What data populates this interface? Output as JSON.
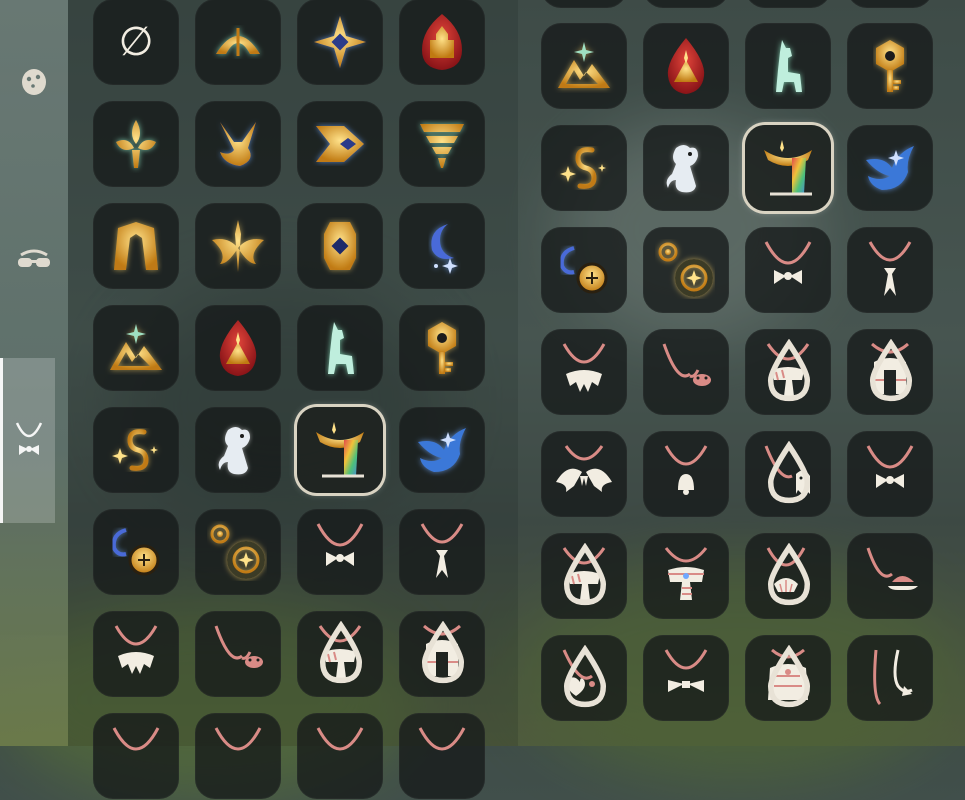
{
  "sidebar": {
    "items": [
      {
        "icon": "face-mask-icon",
        "active": false
      },
      {
        "icon": "sunglasses-icon",
        "active": false
      },
      {
        "icon": "neck-accessory-icon",
        "active": true
      }
    ]
  },
  "empty_slot_symbol": "∅",
  "left_grid": [
    [
      "empty-slot",
      "aquatic-emblem",
      "star-diamond-emblem",
      "castle-emblem"
    ],
    [
      "fleur-emblem",
      "fox-emblem",
      "fish-arrow-emblem",
      "tornado-emblem"
    ],
    [
      "arch-emblem",
      "bird-wings-emblem",
      "gem-emblem",
      "moon-stars-emblem"
    ],
    [
      "mountains-emblem",
      "drop-mountain-emblem",
      "llama-emblem",
      "key-emblem"
    ],
    [
      "swirl-emblem",
      "rat-emblem",
      "rainbow-bowl-emblem",
      "blue-bird-emblem"
    ],
    [
      "crescent-lantern-emblem",
      "gear-emblem",
      "bow-necklace",
      "tie-necklace"
    ],
    [
      "fur-collar-necklace",
      "crab-necklace",
      "scarf-necklace",
      "pendant-bib-necklace"
    ],
    [
      "necklace",
      "necklace",
      "necklace",
      "necklace"
    ]
  ],
  "right_grid": [
    [
      "mountains-emblem",
      "drop-mountain-emblem",
      "llama-emblem",
      "key-emblem"
    ],
    [
      "swirl-emblem",
      "rat-emblem",
      "rainbow-bowl-emblem",
      "blue-bird-emblem"
    ],
    [
      "crescent-lantern-emblem",
      "gear-emblem",
      "bow-necklace",
      "tie-necklace"
    ],
    [
      "fur-collar-necklace",
      "crab-necklace",
      "scarf-necklace",
      "pendant-bib-necklace"
    ],
    [
      "wing-collar-necklace",
      "bell-necklace",
      "ghost-necklace",
      "bow-necklace"
    ],
    [
      "scarf-necklace",
      "striped-scarf-necklace",
      "shell-necklace",
      "turtle-necklace"
    ],
    [
      "heart-necklace",
      "bow-tie-necklace",
      "cape-necklace",
      "white-string-necklace"
    ]
  ],
  "selected_item": "rainbow-bowl-emblem",
  "colors": {
    "tile_bg": "#1a1f1d",
    "gold": "#e8b23a",
    "teal_glow": "#9fe0c2",
    "cord": "#d98b86",
    "cream": "#f2ede2",
    "blue": "#4a88d8",
    "red": "#b8232a"
  }
}
